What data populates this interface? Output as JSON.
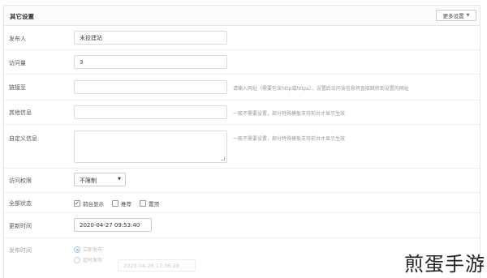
{
  "panel": {
    "title": "其它设置",
    "more_button": "更多设置"
  },
  "fields": {
    "publisher": {
      "label": "发布人",
      "value": "未投建站"
    },
    "views": {
      "label": "访问量",
      "value": "3"
    },
    "link": {
      "label": "链接至",
      "value": "",
      "hint": "请输入网址（需要包含http或https），设置后访问该信息将直接跳转到设置的网址"
    },
    "other_info": {
      "label": "其他信息",
      "value": "",
      "hint": "一般不需要设置，部分特殊模板支持前台才显示生效"
    },
    "custom_info": {
      "label": "自定义信息",
      "value": "",
      "hint": "一般不需要设置，部分特殊模板支持前台才显示生效"
    },
    "access": {
      "label": "访问权限",
      "selected": "不限制"
    },
    "status": {
      "label": "全部状态",
      "options": [
        {
          "label": "前台显示",
          "checked": true
        },
        {
          "label": "推荐",
          "checked": false
        },
        {
          "label": "置顶",
          "checked": false
        }
      ]
    },
    "update_time": {
      "label": "更新时间",
      "value": "2020-04-27 09:53:40"
    },
    "publish_time": {
      "label": "发布时间",
      "immediate": "立即发布",
      "scheduled": "定时发布",
      "scheduled_value": "2020-04-26 17:36:28"
    }
  },
  "watermark": "煎蛋手游"
}
